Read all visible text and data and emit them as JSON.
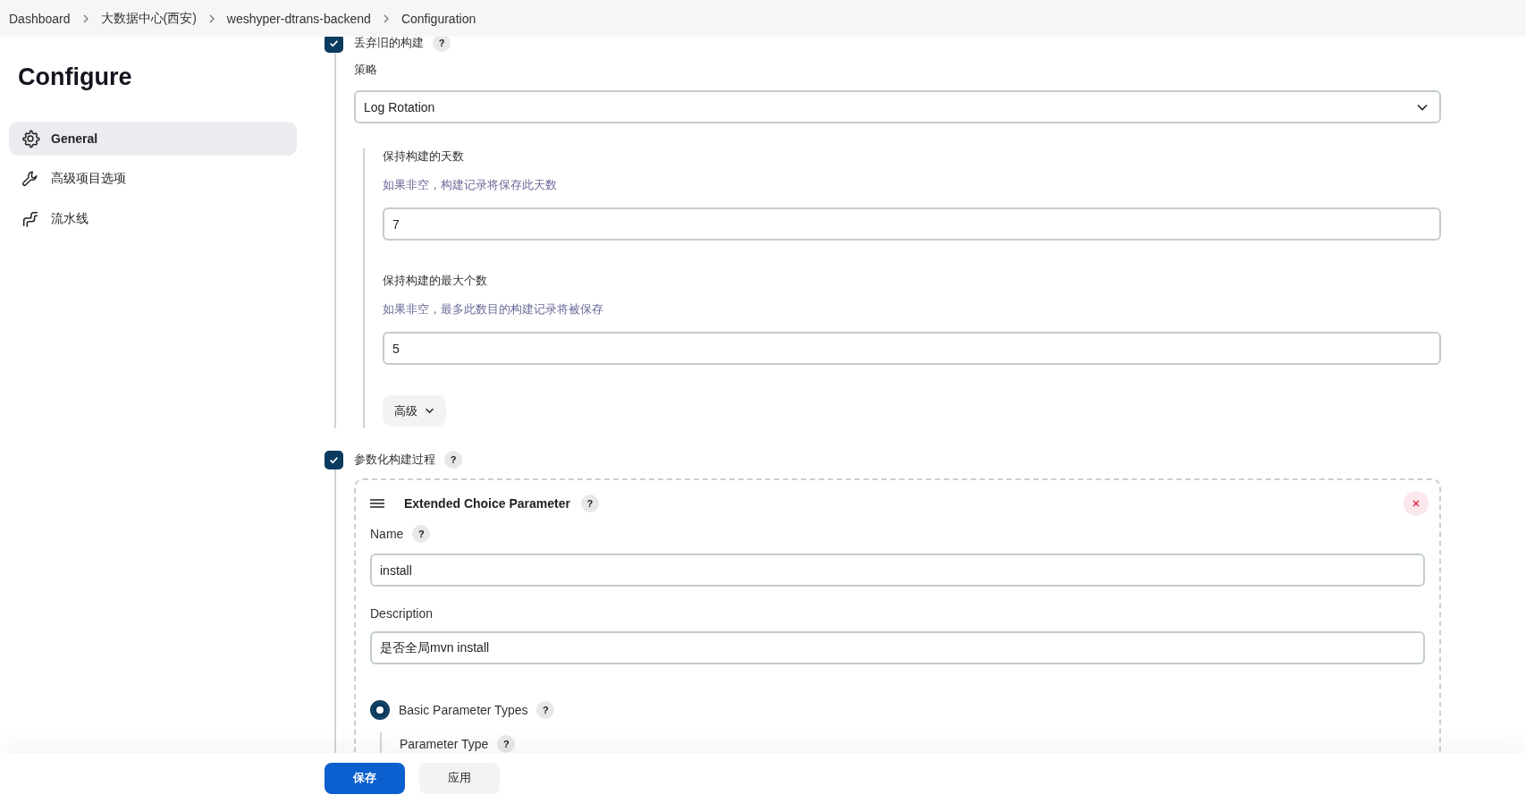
{
  "breadcrumb": [
    "Dashboard",
    "大数据中心(西安)",
    "weshyper-dtrans-backend",
    "Configuration"
  ],
  "sidebar": {
    "title": "Configure",
    "items": [
      {
        "label": "General",
        "selected": true
      },
      {
        "label": "高级项目选项",
        "selected": false
      },
      {
        "label": "流水线",
        "selected": false
      }
    ]
  },
  "discard_builds": {
    "label": "丢弃旧的构建",
    "help": "?",
    "checked": true,
    "strategy_label": "策略",
    "strategy_value": "Log Rotation",
    "fields": [
      {
        "label": "保持构建的天数",
        "hint": "如果非空，构建记录将保存此天数",
        "value": "7"
      },
      {
        "label": "保持构建的最大个数",
        "hint": "如果非空，最多此数目的构建记录将被保存",
        "value": "5"
      }
    ],
    "advanced_button": "高级"
  },
  "parameterized": {
    "label": "参数化构建过程",
    "help": "?",
    "checked": true,
    "card": {
      "title": "Extended Choice Parameter",
      "help": "?",
      "fields": [
        {
          "label": "Name",
          "help": "?",
          "value": "install"
        },
        {
          "label": "Description",
          "value": "是否全局mvn install"
        }
      ],
      "radio": {
        "label": "Basic Parameter Types",
        "help": "?",
        "selected": true
      },
      "sub_label": "Parameter Type",
      "sub_help": "?"
    }
  },
  "buttons": [
    {
      "label": "保存",
      "kind": "primary"
    },
    {
      "label": "应用",
      "kind": "secondary"
    }
  ]
}
